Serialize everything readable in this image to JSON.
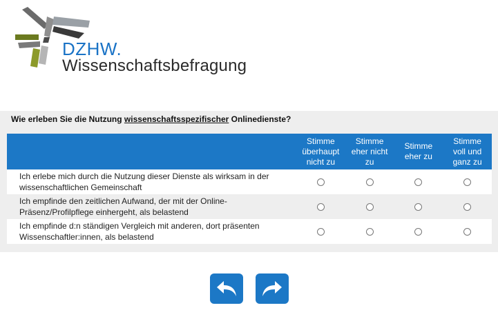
{
  "logo": {
    "brand": "DZHW.",
    "subtitle": "Wissenschaftsbefragung"
  },
  "question": {
    "text_before": "Wie erleben Sie die Nutzung ",
    "text_underlined": "wissenschaftsspezifischer",
    "text_after": " Onlinedienste?"
  },
  "columns": [
    "Stimme\nüberhaupt\nnicht zu",
    "Stimme\neher nicht\nzu",
    "Stimme\neher zu",
    "Stimme\nvoll und\nganz zu"
  ],
  "items": [
    "Ich erlebe mich durch die Nutzung dieser Dienste als wirksam in der wissenschaftlichen Gemeinschaft",
    "Ich empfinde den zeitlichen Aufwand, der mit der Online-Präsenz/Profilpflege einhergeht, als belastend",
    "Ich empfinde d:n ständigen Vergleich mit anderen, dort präsenten Wissenschaftler:innen, als belastend"
  ],
  "nav": {
    "back_icon": "arrow-back-icon",
    "next_icon": "arrow-forward-icon"
  },
  "colors": {
    "accent": "#1c78c6"
  }
}
